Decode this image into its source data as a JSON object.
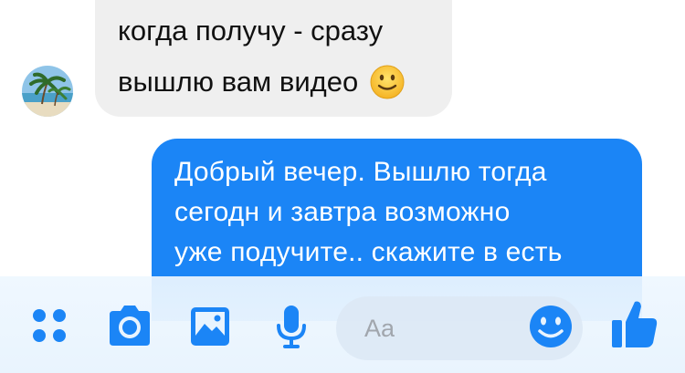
{
  "messages": {
    "incoming": {
      "lines": [
        "когда получу - сразу",
        "вышлю вам видео"
      ],
      "emoji": "slightly-smiling-face-emoji"
    },
    "outgoing": {
      "lines": [
        "Добрый вечер. Вышлю тогда",
        "сегодн и завтра возможно",
        "уже подучите.. скажите в есть"
      ]
    }
  },
  "composer": {
    "placeholder": "Aa",
    "icons": [
      "apps-icon",
      "camera-icon",
      "image-icon",
      "microphone-icon",
      "emoji-icon",
      "thumbs-up-icon"
    ]
  },
  "colors": {
    "accent": "#1b85f6",
    "incoming_bubble": "#efefef",
    "toolbar_bg": "#e9f4fe"
  }
}
